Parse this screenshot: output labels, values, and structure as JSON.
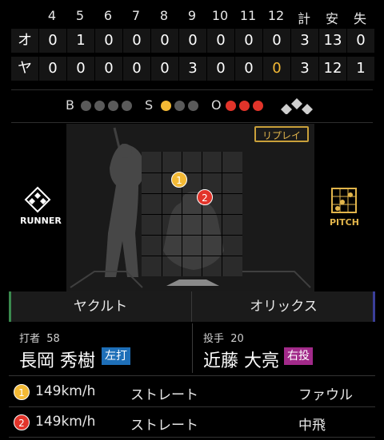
{
  "scoreboard": {
    "innings": [
      "4",
      "5",
      "6",
      "7",
      "8",
      "9",
      "10",
      "11",
      "12"
    ],
    "total_headers": [
      "計",
      "安",
      "失"
    ],
    "rows": [
      {
        "team": "オ",
        "scores": [
          "0",
          "1",
          "0",
          "0",
          "0",
          "0",
          "0",
          "0",
          "0"
        ],
        "totals": [
          "3",
          "13",
          "0"
        ]
      },
      {
        "team": "ヤ",
        "scores": [
          "0",
          "0",
          "0",
          "0",
          "0",
          "3",
          "0",
          "0",
          "0"
        ],
        "totals": [
          "3",
          "12",
          "1"
        ]
      }
    ],
    "highlight_color": "#f3b935"
  },
  "count": {
    "b_label": "B",
    "s_label": "S",
    "o_label": "O",
    "balls": 0,
    "strikes": 1,
    "outs": 3,
    "colors": {
      "ball": "#2e8bd8",
      "strike": "#f3b935",
      "out": "#e2342a",
      "off": "#5a5a5a"
    }
  },
  "field": {
    "replay_label": "リプレイ",
    "runner_label": "RUNNER",
    "pitch_label": "PITCH",
    "markers": [
      {
        "num": "1",
        "color": "#f3b935"
      },
      {
        "num": "2",
        "color": "#e2342a"
      }
    ]
  },
  "teams": {
    "away": "ヤクルト",
    "home": "オリックス",
    "away_color": "#3a8a4e",
    "home_color": "#3b3f9a"
  },
  "batter": {
    "label": "打者",
    "number": "58",
    "name": "長岡 秀樹",
    "hand": "左打",
    "hand_color": "#1e6fb8"
  },
  "pitcher": {
    "label": "投手",
    "number": "20",
    "name": "近藤 大亮",
    "hand": "右投",
    "hand_color": "#a22a8a"
  },
  "pitches": [
    {
      "num": "1",
      "speed": "149km/h",
      "type": "ストレート",
      "result": "ファウル",
      "color": "#f3b935"
    },
    {
      "num": "2",
      "speed": "149km/h",
      "type": "ストレート",
      "result": "中飛",
      "color": "#e2342a"
    }
  ]
}
